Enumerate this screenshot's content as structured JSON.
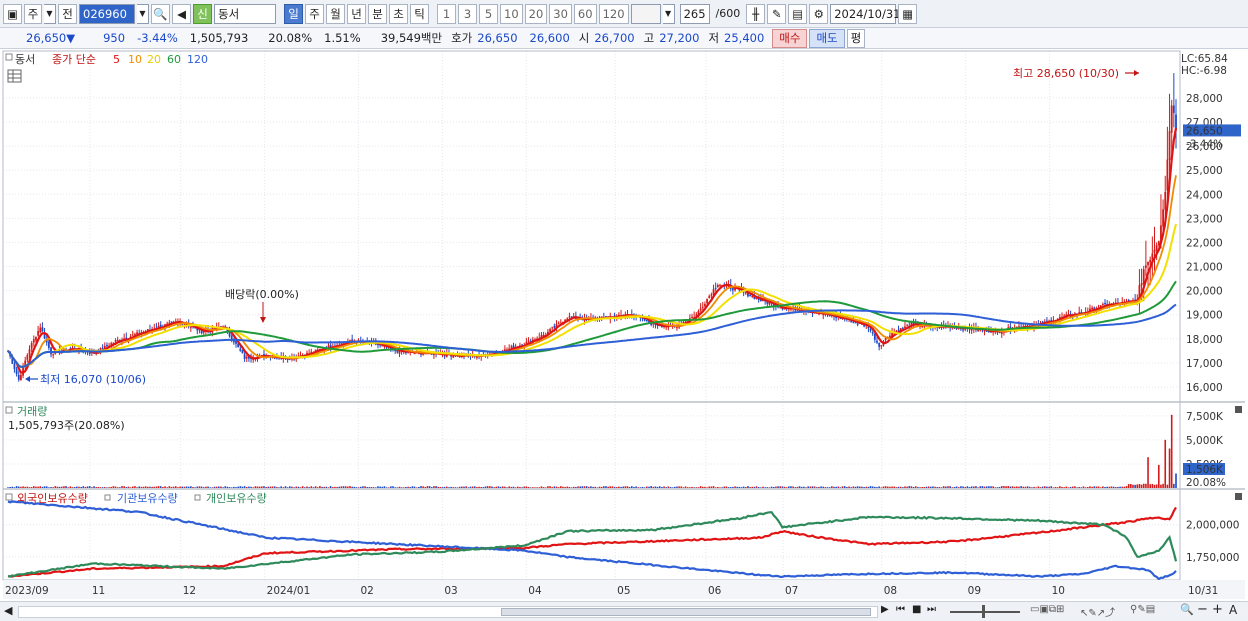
{
  "toolbar": {
    "type_label": "주",
    "prev_label": "전",
    "code": "026960",
    "new_badge": "신",
    "name": "동서",
    "periods": [
      "일",
      "주",
      "월",
      "년",
      "분",
      "초",
      "틱"
    ],
    "active_period": "일",
    "intervals": [
      "1",
      "3",
      "5",
      "10",
      "20",
      "30",
      "60",
      "120"
    ],
    "count_value": "265",
    "count_total": "/600",
    "date": "2024/10/31"
  },
  "quote": {
    "price": "26,650",
    "arrow": "▼",
    "change": "950",
    "change_pct": "-3.44%",
    "volume": "1,505,793",
    "volume_ratio": "20.08%",
    "turnover_pct": "1.51%",
    "amount": "39,549백만",
    "ask_label": "호가",
    "ask": "26,650",
    "bid": "26,600",
    "open_label": "시",
    "open": "26,700",
    "high_label": "고",
    "high": "27,200",
    "low_label": "저",
    "low": "25,400",
    "buy_label": "매수",
    "sell_label": "매도",
    "eval_label": "평"
  },
  "colors": {
    "up": "#d41a1a",
    "down": "#1a49c9",
    "ma5": "#e01414",
    "ma10": "#f08c00",
    "ma20": "#f2e000",
    "ma60": "#1f9a3a",
    "ma120": "#2e5fd6",
    "foreign": "#e01414",
    "institution": "#2e5fd6",
    "individual": "#2e8a5a",
    "price_tag": "#2f64c8"
  },
  "chart_data": [
    {
      "type": "candlestick",
      "title": "동서",
      "legend": {
        "tag": "동서",
        "ma_label": "종가 단순",
        "ma_periods": [
          "5",
          "10",
          "20",
          "60",
          "120"
        ]
      },
      "x_ticks": [
        "2023/09",
        "11",
        "12",
        "2024/01",
        "02",
        "03",
        "04",
        "05",
        "06",
        "07",
        "08",
        "09",
        "10",
        "10/31"
      ],
      "y_ticks": [
        "28,000",
        "27,000",
        "26,000",
        "25,000",
        "24,000",
        "23,000",
        "22,000",
        "21,000",
        "20,000",
        "19,000",
        "18,000",
        "17,000",
        "16,000"
      ],
      "ylim": [
        15500,
        29200
      ],
      "lc": "LC:65.84",
      "hc": "HC:-6.98",
      "current_price": "26,650",
      "current_change": "-3.44%",
      "annotations": {
        "high": "최고 28,650 (10/30)",
        "low": "최저 16,070 (10/06)",
        "dividend": "배당락(0.00%)"
      },
      "close_keypoints": [
        [
          0,
          17500
        ],
        [
          5,
          16300
        ],
        [
          10,
          17600
        ],
        [
          15,
          18500
        ],
        [
          20,
          17400
        ],
        [
          30,
          17600
        ],
        [
          40,
          17400
        ],
        [
          50,
          17900
        ],
        [
          60,
          18200
        ],
        [
          70,
          18500
        ],
        [
          80,
          18700
        ],
        [
          90,
          18300
        ],
        [
          100,
          18500
        ],
        [
          105,
          17900
        ],
        [
          110,
          17200
        ],
        [
          120,
          17300
        ],
        [
          130,
          17200
        ],
        [
          140,
          17400
        ],
        [
          150,
          17700
        ],
        [
          160,
          17900
        ],
        [
          170,
          17800
        ],
        [
          180,
          17500
        ],
        [
          190,
          17400
        ],
        [
          200,
          17400
        ],
        [
          210,
          17300
        ],
        [
          220,
          17300
        ],
        [
          230,
          17500
        ],
        [
          240,
          17800
        ],
        [
          250,
          18200
        ],
        [
          260,
          18900
        ],
        [
          270,
          18800
        ],
        [
          280,
          18900
        ],
        [
          290,
          19000
        ],
        [
          300,
          18600
        ],
        [
          310,
          18500
        ],
        [
          320,
          19000
        ],
        [
          330,
          20300
        ],
        [
          340,
          20000
        ],
        [
          350,
          19600
        ],
        [
          360,
          19300
        ],
        [
          370,
          19200
        ],
        [
          380,
          19000
        ],
        [
          390,
          18800
        ],
        [
          400,
          18500
        ],
        [
          405,
          17700
        ],
        [
          410,
          18200
        ],
        [
          420,
          18600
        ],
        [
          430,
          18500
        ],
        [
          440,
          18500
        ],
        [
          450,
          18400
        ],
        [
          460,
          18300
        ],
        [
          470,
          18500
        ],
        [
          480,
          18600
        ],
        [
          490,
          18900
        ],
        [
          500,
          19100
        ],
        [
          510,
          19400
        ],
        [
          520,
          19500
        ],
        [
          525,
          19600
        ],
        [
          528,
          20900
        ],
        [
          532,
          21600
        ],
        [
          535,
          22200
        ],
        [
          538,
          24200
        ],
        [
          540,
          26700
        ],
        [
          541,
          27900
        ],
        [
          543,
          26650
        ]
      ]
    },
    {
      "type": "bar",
      "title": "거래량",
      "volume_text": "1,505,793주(20.08%)",
      "y_ticks": [
        "7,500K",
        "5,000K",
        "2,500K"
      ],
      "current_volume": "1,506K",
      "current_ratio": "20.08%",
      "ylim": [
        0,
        8000
      ],
      "spikes": [
        [
          530,
          3200
        ],
        [
          535,
          2400
        ],
        [
          538,
          5000
        ],
        [
          540,
          4100
        ],
        [
          541,
          7600
        ],
        [
          543,
          1506
        ]
      ]
    },
    {
      "type": "line",
      "legend": [
        "외국인보유수량",
        "기관보유수량",
        "개인보유수량"
      ],
      "y_ticks": [
        "2,000,000",
        "1,750,000"
      ],
      "ylim": [
        1580000,
        2230000
      ],
      "series": [
        {
          "name": "외국인보유수량",
          "color_key": "foreign",
          "keypoints": [
            [
              0,
              1600000
            ],
            [
              40,
              1660000
            ],
            [
              100,
              1680000
            ],
            [
              120,
              1780000
            ],
            [
              180,
              1810000
            ],
            [
              240,
              1820000
            ],
            [
              260,
              1850000
            ],
            [
              350,
              1900000
            ],
            [
              360,
              1950000
            ],
            [
              370,
              1920000
            ],
            [
              400,
              1850000
            ],
            [
              440,
              1870000
            ],
            [
              480,
              1940000
            ],
            [
              500,
              1980000
            ],
            [
              520,
              2020000
            ],
            [
              535,
              2060000
            ],
            [
              540,
              2040000
            ],
            [
              543,
              2130000
            ]
          ]
        },
        {
          "name": "기관보유수량",
          "color_key": "institution",
          "keypoints": [
            [
              0,
              2180000
            ],
            [
              60,
              2100000
            ],
            [
              120,
              1900000
            ],
            [
              180,
              1850000
            ],
            [
              240,
              1800000
            ],
            [
              260,
              1750000
            ],
            [
              350,
              1610000
            ],
            [
              360,
              1600000
            ],
            [
              400,
              1620000
            ],
            [
              440,
              1630000
            ],
            [
              480,
              1600000
            ],
            [
              500,
              1620000
            ],
            [
              515,
              1680000
            ],
            [
              530,
              1650000
            ],
            [
              535,
              1580000
            ],
            [
              540,
              1610000
            ],
            [
              543,
              1640000
            ]
          ]
        },
        {
          "name": "개인보유수량",
          "color_key": "individual",
          "keypoints": [
            [
              0,
              1600000
            ],
            [
              40,
              1700000
            ],
            [
              100,
              1660000
            ],
            [
              160,
              1770000
            ],
            [
              200,
              1790000
            ],
            [
              240,
              1840000
            ],
            [
              260,
              1950000
            ],
            [
              300,
              1960000
            ],
            [
              340,
              2050000
            ],
            [
              355,
              2100000
            ],
            [
              360,
              1980000
            ],
            [
              400,
              2060000
            ],
            [
              440,
              2050000
            ],
            [
              480,
              2030000
            ],
            [
              510,
              2000000
            ],
            [
              520,
              1900000
            ],
            [
              525,
              1750000
            ],
            [
              535,
              1800000
            ],
            [
              540,
              1900000
            ],
            [
              543,
              1720000
            ]
          ]
        }
      ]
    }
  ]
}
